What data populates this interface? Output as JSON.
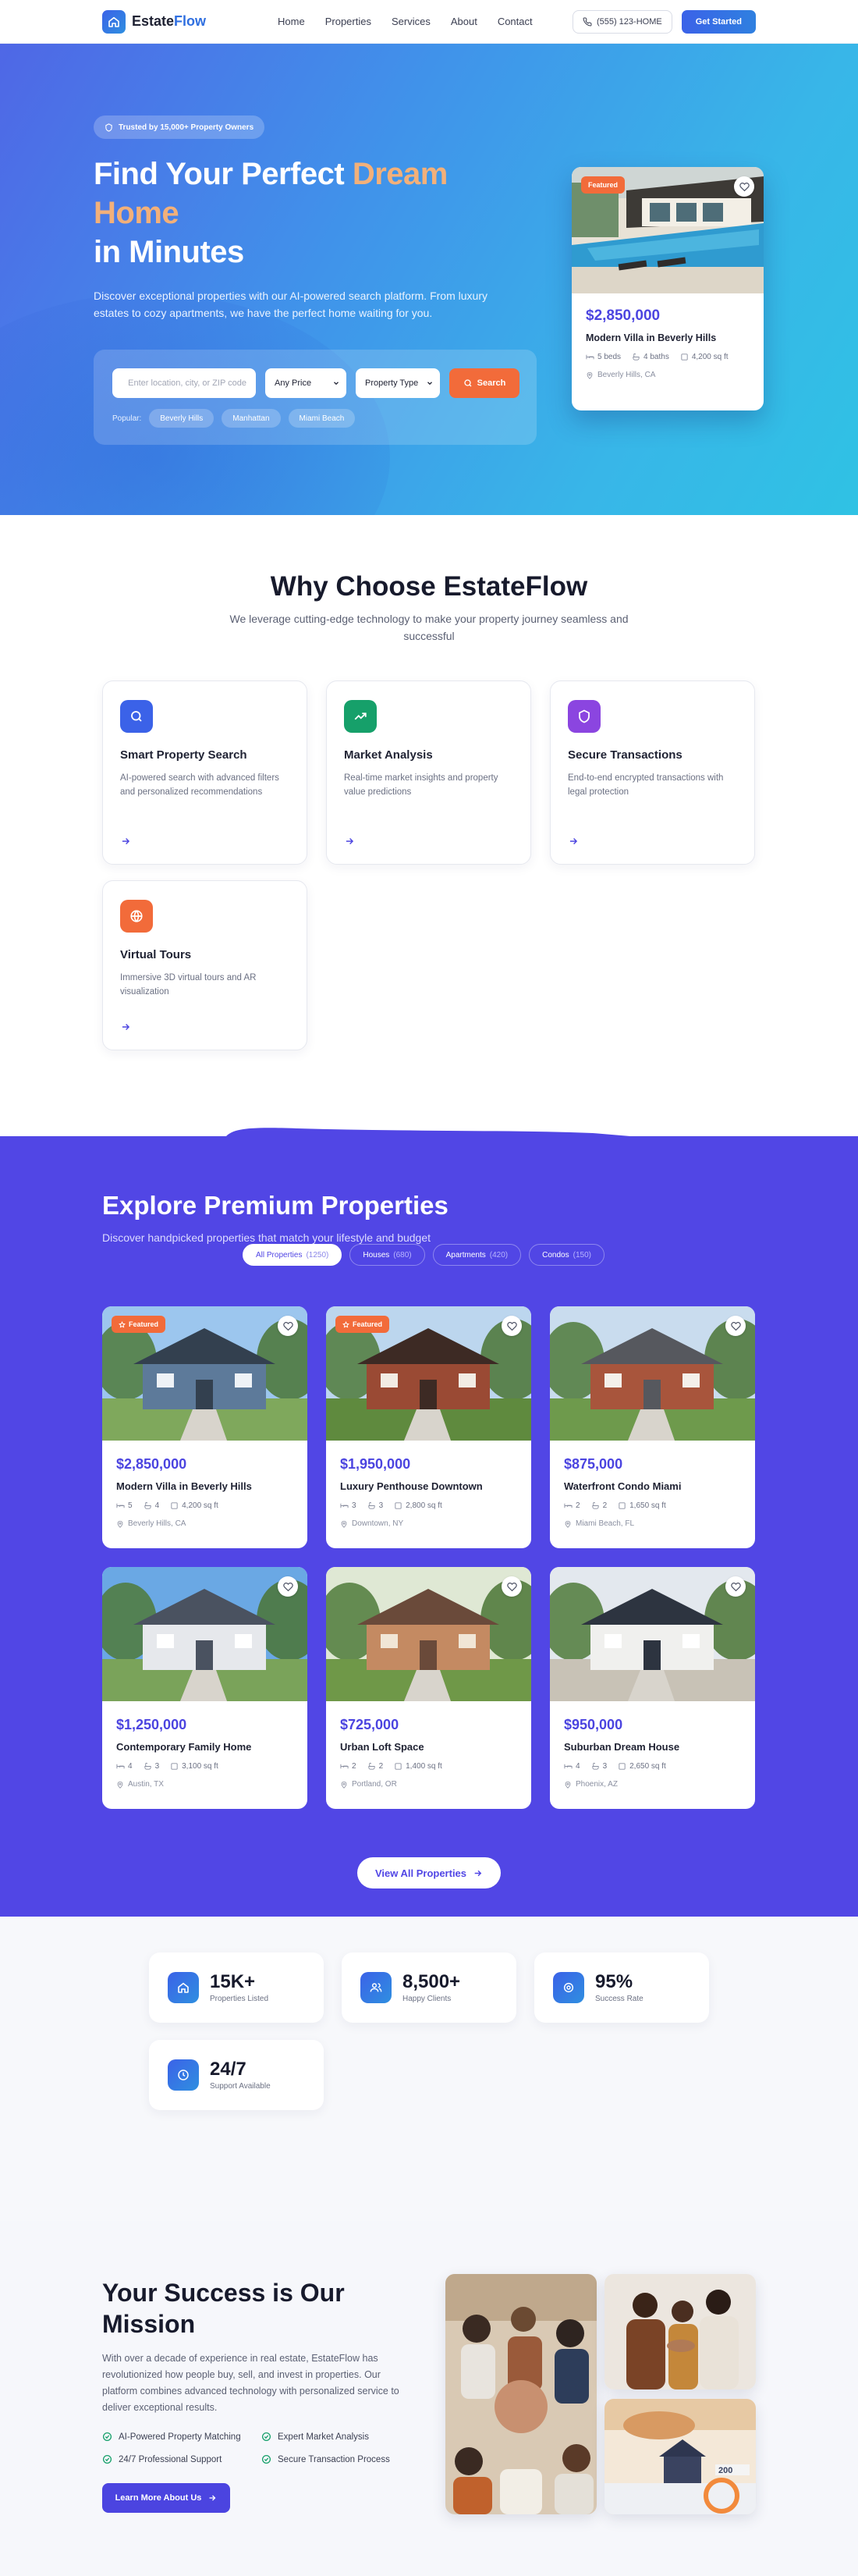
{
  "nav": {
    "brand_part1": "Estate",
    "brand_part2": "Flow",
    "links": [
      "Home",
      "Properties",
      "Services",
      "About",
      "Contact"
    ],
    "phone": "(555) 123-HOME",
    "cta": "Get Started"
  },
  "hero": {
    "trust_badge": "Trusted by 15,000+ Property Owners",
    "title_line1_a": "Find Your Perfect ",
    "title_line1_b": "Dream",
    "title_line2": "Home",
    "title_line3": "in Minutes",
    "subtitle": "Discover exceptional properties with our AI-powered search platform. From luxury estates to cozy apartments, we have the perfect home waiting for you.",
    "search_placeholder": "Enter location, city, or ZIP code",
    "price_select": "Any Price",
    "type_select": "Property Type",
    "search_button": "Search",
    "popular_label": "Popular:",
    "popular": [
      "Beverly Hills",
      "Manhattan",
      "Miami Beach"
    ],
    "card": {
      "badge": "Featured",
      "price": "$2,850,000",
      "title": "Modern Villa in Beverly Hills",
      "beds": "5 beds",
      "baths": "4 baths",
      "sqft": "4,200 sq ft",
      "location": "Beverly Hills, CA"
    }
  },
  "why": {
    "title": "Why Choose EstateFlow",
    "subtitle": "We leverage cutting-edge technology to make your property journey seamless and successful",
    "features": [
      {
        "title": "Smart Property Search",
        "desc": "AI-powered search with advanced filters and personalized recommendations",
        "icon": "search-icon",
        "color": "#3b62e8"
      },
      {
        "title": "Market Analysis",
        "desc": "Real-time market insights and property value predictions",
        "icon": "trending-up-icon",
        "color": "#16a06a"
      },
      {
        "title": "Secure Transactions",
        "desc": "End-to-end encrypted transactions with legal protection",
        "icon": "shield-icon",
        "color": "#8b45e0"
      },
      {
        "title": "Virtual Tours",
        "desc": "Immersive 3D virtual tours and AR visualization",
        "icon": "globe-icon",
        "color": "#f26b3a"
      }
    ]
  },
  "properties": {
    "title": "Explore Premium Properties",
    "subtitle": "Discover handpicked properties that match your lifestyle and budget",
    "tabs": [
      {
        "label": "All Properties",
        "count": "(1250)"
      },
      {
        "label": "Houses",
        "count": "(680)"
      },
      {
        "label": "Apartments",
        "count": "(420)"
      },
      {
        "label": "Condos",
        "count": "(150)"
      }
    ],
    "listings": [
      {
        "price": "$2,850,000",
        "title": "Modern Villa in Beverly Hills",
        "beds": "5",
        "baths": "4",
        "sqft": "4,200 sq ft",
        "location": "Beverly Hills, CA",
        "badge": "Featured"
      },
      {
        "price": "$1,950,000",
        "title": "Luxury Penthouse Downtown",
        "beds": "3",
        "baths": "3",
        "sqft": "2,800 sq ft",
        "location": "Downtown, NY",
        "badge": "Featured"
      },
      {
        "price": "$875,000",
        "title": "Waterfront Condo Miami",
        "beds": "2",
        "baths": "2",
        "sqft": "1,650 sq ft",
        "location": "Miami Beach, FL",
        "badge": ""
      },
      {
        "price": "$1,250,000",
        "title": "Contemporary Family Home",
        "beds": "4",
        "baths": "3",
        "sqft": "3,100 sq ft",
        "location": "Austin, TX",
        "badge": ""
      },
      {
        "price": "$725,000",
        "title": "Urban Loft Space",
        "beds": "2",
        "baths": "2",
        "sqft": "1,400 sq ft",
        "location": "Portland, OR",
        "badge": ""
      },
      {
        "price": "$950,000",
        "title": "Suburban Dream House",
        "beds": "4",
        "baths": "3",
        "sqft": "2,650 sq ft",
        "location": "Phoenix, AZ",
        "badge": ""
      }
    ],
    "view_all": "View All Properties"
  },
  "stats": [
    {
      "value": "15K+",
      "label": "Properties Listed",
      "icon": "home-icon"
    },
    {
      "value": "8,500+",
      "label": "Happy Clients",
      "icon": "users-icon"
    },
    {
      "value": "95%",
      "label": "Success Rate",
      "icon": "award-icon"
    },
    {
      "value": "24/7",
      "label": "Support Available",
      "icon": "clock-icon"
    }
  ],
  "mission": {
    "title": "Your Success is Our Mission",
    "body": "With over a decade of experience in real estate, EstateFlow has revolutionized how people buy, sell, and invest in properties. Our platform combines advanced technology with personalized service to deliver exceptional results.",
    "checks": [
      "AI-Powered Property Matching",
      "Expert Market Analysis",
      "24/7 Professional Support",
      "Secure Transaction Process"
    ],
    "button": "Learn More About Us"
  },
  "colors": {
    "brand": "#3b62e8",
    "accent": "#f26b3a",
    "purple": "#5146e5",
    "gold": "#f2b07a"
  }
}
